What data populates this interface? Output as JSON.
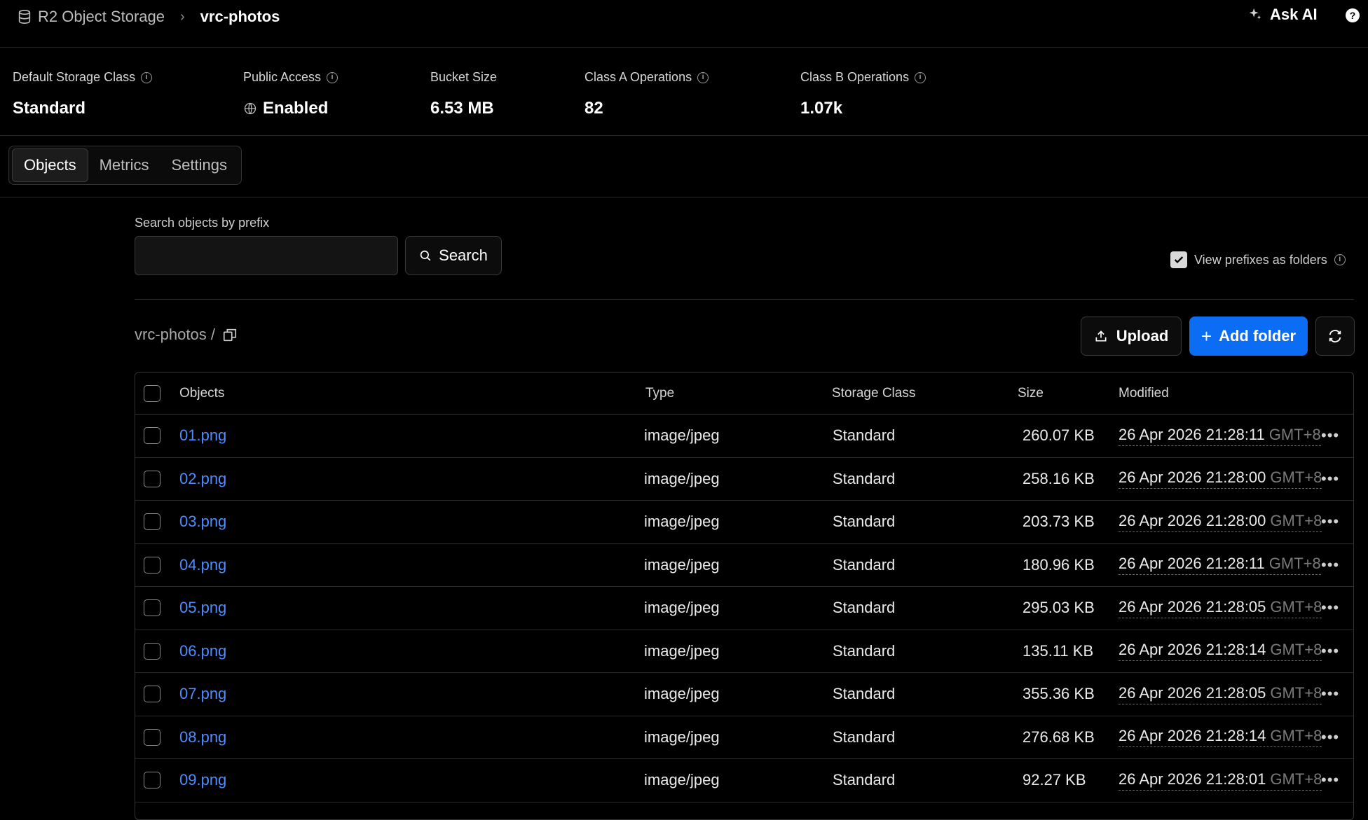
{
  "header": {
    "breadcrumb_root": "R2 Object Storage",
    "breadcrumb_current": "vrc-photos",
    "ask_ai": "Ask AI"
  },
  "stats": [
    {
      "label": "Default Storage Class",
      "value": "Standard"
    },
    {
      "label": "Public Access",
      "value": "Enabled"
    },
    {
      "label": "Bucket Size",
      "value": "6.53 MB"
    },
    {
      "label": "Class A Operations",
      "value": "82"
    },
    {
      "label": "Class B Operations",
      "value": "1.07k"
    }
  ],
  "tabs": [
    {
      "label": "Objects",
      "active": true
    },
    {
      "label": "Metrics",
      "active": false
    },
    {
      "label": "Settings",
      "active": false
    }
  ],
  "search": {
    "label": "Search objects by prefix",
    "value": "",
    "button": "Search"
  },
  "view_prefixes": {
    "label": "View prefixes as folders",
    "checked": true
  },
  "path": "vrc-photos /",
  "actions": {
    "upload": "Upload",
    "add_folder": "Add folder"
  },
  "table": {
    "columns": [
      "Objects",
      "Type",
      "Storage Class",
      "Size",
      "Modified"
    ],
    "rows": [
      {
        "name": "01.png",
        "type": "image/jpeg",
        "storage_class": "Standard",
        "size": "260.07 KB",
        "modified": "26 Apr 2026 21:28:11",
        "tz": "GMT+8"
      },
      {
        "name": "02.png",
        "type": "image/jpeg",
        "storage_class": "Standard",
        "size": "258.16 KB",
        "modified": "26 Apr 2026 21:28:00",
        "tz": "GMT+8"
      },
      {
        "name": "03.png",
        "type": "image/jpeg",
        "storage_class": "Standard",
        "size": "203.73 KB",
        "modified": "26 Apr 2026 21:28:00",
        "tz": "GMT+8"
      },
      {
        "name": "04.png",
        "type": "image/jpeg",
        "storage_class": "Standard",
        "size": "180.96 KB",
        "modified": "26 Apr 2026 21:28:11",
        "tz": "GMT+8"
      },
      {
        "name": "05.png",
        "type": "image/jpeg",
        "storage_class": "Standard",
        "size": "295.03 KB",
        "modified": "26 Apr 2026 21:28:05",
        "tz": "GMT+8"
      },
      {
        "name": "06.png",
        "type": "image/jpeg",
        "storage_class": "Standard",
        "size": "135.11 KB",
        "modified": "26 Apr 2026 21:28:14",
        "tz": "GMT+8"
      },
      {
        "name": "07.png",
        "type": "image/jpeg",
        "storage_class": "Standard",
        "size": "355.36 KB",
        "modified": "26 Apr 2026 21:28:05",
        "tz": "GMT+8"
      },
      {
        "name": "08.png",
        "type": "image/jpeg",
        "storage_class": "Standard",
        "size": "276.68 KB",
        "modified": "26 Apr 2026 21:28:14",
        "tz": "GMT+8"
      },
      {
        "name": "09.png",
        "type": "image/jpeg",
        "storage_class": "Standard",
        "size": "92.27 KB",
        "modified": "26 Apr 2026 21:28:01",
        "tz": "GMT+8"
      }
    ]
  },
  "colors": {
    "accent": "#0b6cf4",
    "link": "#4d8dff",
    "background": "#000000"
  }
}
